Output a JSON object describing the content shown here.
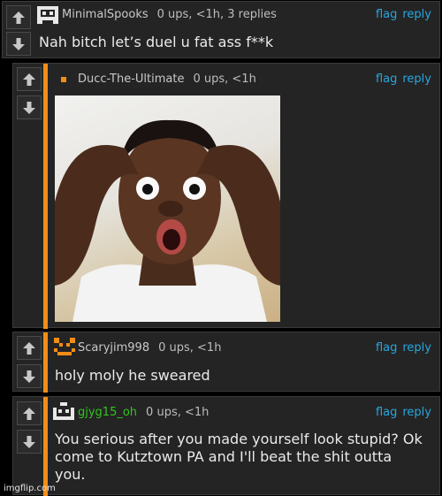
{
  "actions": {
    "flag": "flag",
    "reply": "reply"
  },
  "comments": [
    {
      "user": "MinimalSpooks",
      "stats": "0 ups, <1h, 3 replies",
      "text": "Nah bitch let’s duel u fat ass f**k"
    },
    {
      "user": "Ducc-The-Ultimate",
      "stats": "0 ups, <1h",
      "text": ""
    },
    {
      "user": "Scaryjim998",
      "stats": "0 ups, <1h",
      "text": "holy moly he sweared"
    },
    {
      "user": "gjyg15_oh",
      "stats": "0 ups, <1h",
      "text": "You serious after you made yourself look stupid? Ok come to Kutztown PA and I'll beat the shit outta you."
    }
  ],
  "watermark": "imgflip.com",
  "colors": {
    "thread_bar": "#f28e15",
    "link": "#27a7e0",
    "green_user": "#31c41f"
  },
  "icons": [
    "upvote-arrow-icon",
    "downvote-arrow-icon",
    "pixel-avatar-icon"
  ]
}
